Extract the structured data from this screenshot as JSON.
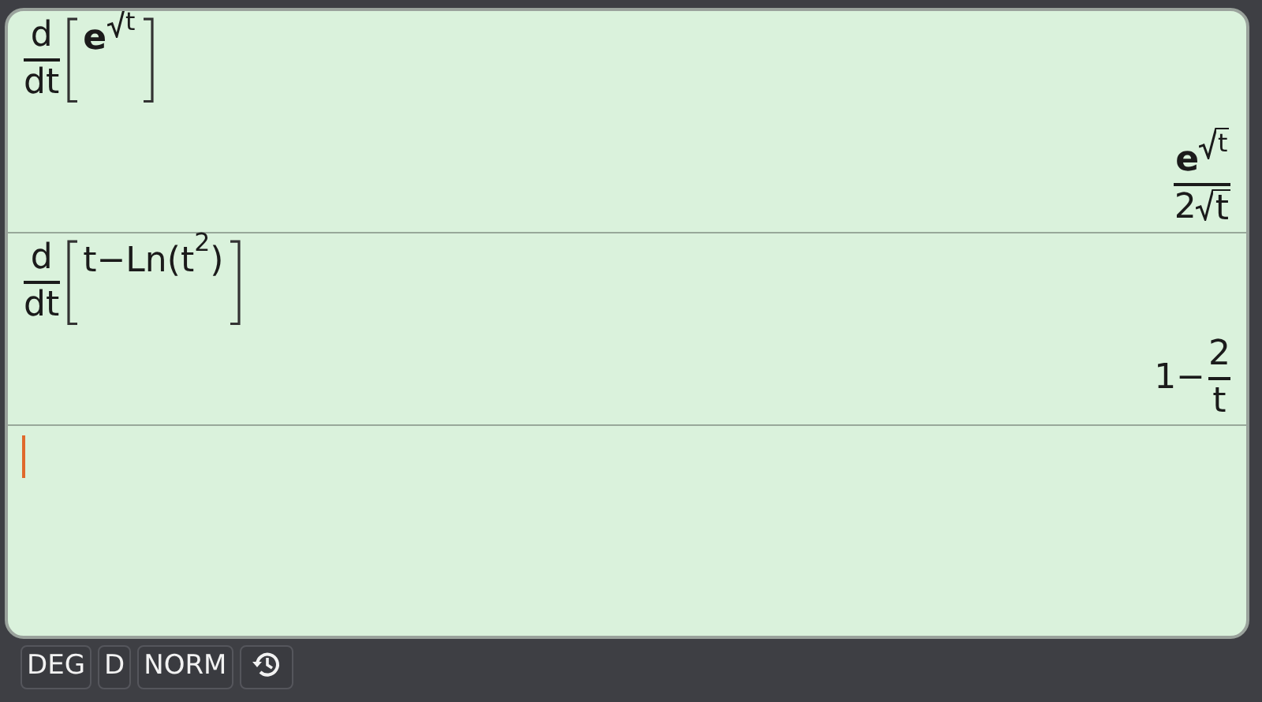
{
  "history": [
    {
      "input": [
        {
          "kind": "frac",
          "num": [
            {
              "kind": "text",
              "text": "d"
            }
          ],
          "den": [
            {
              "kind": "text",
              "text": "dt"
            }
          ]
        },
        {
          "kind": "bracket",
          "body": [
            {
              "kind": "sup",
              "base": [
                {
                  "kind": "const",
                  "text": "e"
                }
              ],
              "exp": [
                {
                  "kind": "sqrt",
                  "body": [
                    {
                      "kind": "text",
                      "text": "t"
                    }
                  ]
                }
              ]
            }
          ]
        }
      ],
      "output": [
        {
          "kind": "frac",
          "num": [
            {
              "kind": "sup",
              "base": [
                {
                  "kind": "const",
                  "text": "e"
                }
              ],
              "exp": [
                {
                  "kind": "sqrt",
                  "body": [
                    {
                      "kind": "text",
                      "text": "t"
                    }
                  ]
                }
              ]
            }
          ],
          "den": [
            {
              "kind": "text",
              "text": "2"
            },
            {
              "kind": "sqrt",
              "body": [
                {
                  "kind": "text",
                  "text": "t"
                }
              ]
            }
          ]
        }
      ]
    },
    {
      "input": [
        {
          "kind": "frac",
          "num": [
            {
              "kind": "text",
              "text": "d"
            }
          ],
          "den": [
            {
              "kind": "text",
              "text": "dt"
            }
          ]
        },
        {
          "kind": "bracket",
          "body": [
            {
              "kind": "text",
              "text": "t−Ln("
            },
            {
              "kind": "sup",
              "base": [
                {
                  "kind": "text",
                  "text": "t"
                }
              ],
              "exp": [
                {
                  "kind": "text",
                  "text": "2"
                }
              ]
            },
            {
              "kind": "text",
              "text": ")"
            }
          ]
        }
      ],
      "output": [
        {
          "kind": "text",
          "text": "1−"
        },
        {
          "kind": "frac",
          "num": [
            {
              "kind": "text",
              "text": "2"
            }
          ],
          "den": [
            {
              "kind": "text",
              "text": "t"
            }
          ]
        }
      ]
    }
  ],
  "entry_line": {
    "cursor": true
  },
  "status_bar": [
    {
      "kind": "text",
      "label": "DEG"
    },
    {
      "kind": "text",
      "label": "D"
    },
    {
      "kind": "text",
      "label": "NORM"
    },
    {
      "kind": "history"
    }
  ]
}
